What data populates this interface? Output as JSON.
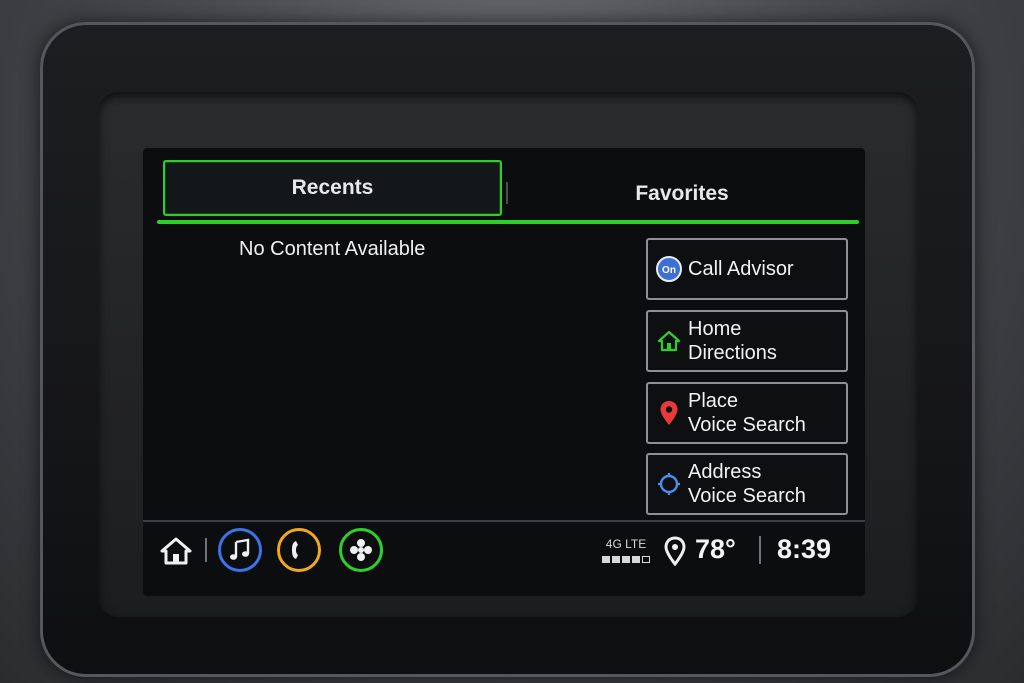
{
  "tabs": {
    "recents": "Recents",
    "favorites": "Favorites"
  },
  "content": {
    "empty_message": "No Content Available"
  },
  "actions": [
    {
      "line1": "Call Advisor",
      "line2": "",
      "icon": "onstar-icon",
      "icon_text": "On"
    },
    {
      "line1": "Home",
      "line2": "Directions",
      "icon": "home-icon"
    },
    {
      "line1": "Place",
      "line2": "Voice Search",
      "icon": "map-pin-icon"
    },
    {
      "line1": "Address",
      "line2": "Voice Search",
      "icon": "crosshair-icon"
    }
  ],
  "status": {
    "network": "4G LTE",
    "signal_bars": 4,
    "signal_total": 5,
    "temperature": "78°",
    "time": "8:39"
  },
  "colors": {
    "accent_green": "#2fcf2a",
    "audio_blue": "#3b74e8",
    "phone_orange": "#f0a81d",
    "pin_red": "#e83a3a",
    "crosshair_blue": "#4a8cf0"
  }
}
